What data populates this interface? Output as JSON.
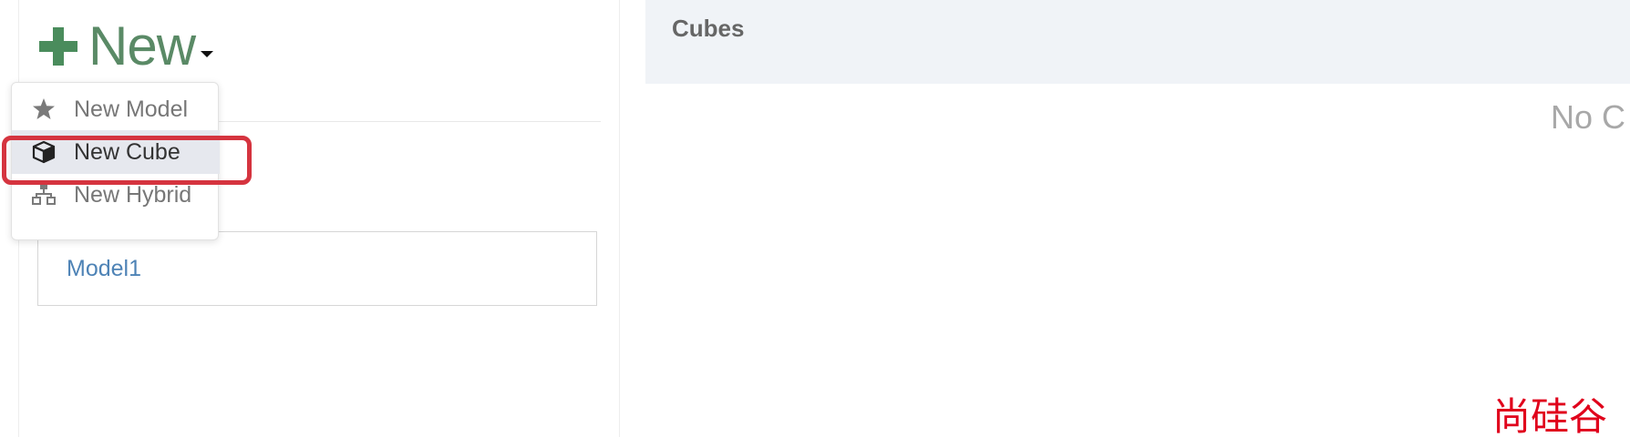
{
  "new_button": {
    "label": "New",
    "icon": "plus-icon",
    "accent": "#4a8c5c"
  },
  "menu": {
    "items": [
      {
        "label": "New Model",
        "icon": "star-icon"
      },
      {
        "label": "New Cube",
        "icon": "cube-icon",
        "active": true
      },
      {
        "label": "New Hybrid",
        "icon": "sitemap-icon"
      }
    ],
    "highlight_color": "#d5343f"
  },
  "models": [
    {
      "name": "Model1"
    }
  ],
  "cubes_panel": {
    "title": "Cubes",
    "empty_message": "No C"
  },
  "watermark": "尚硅谷"
}
